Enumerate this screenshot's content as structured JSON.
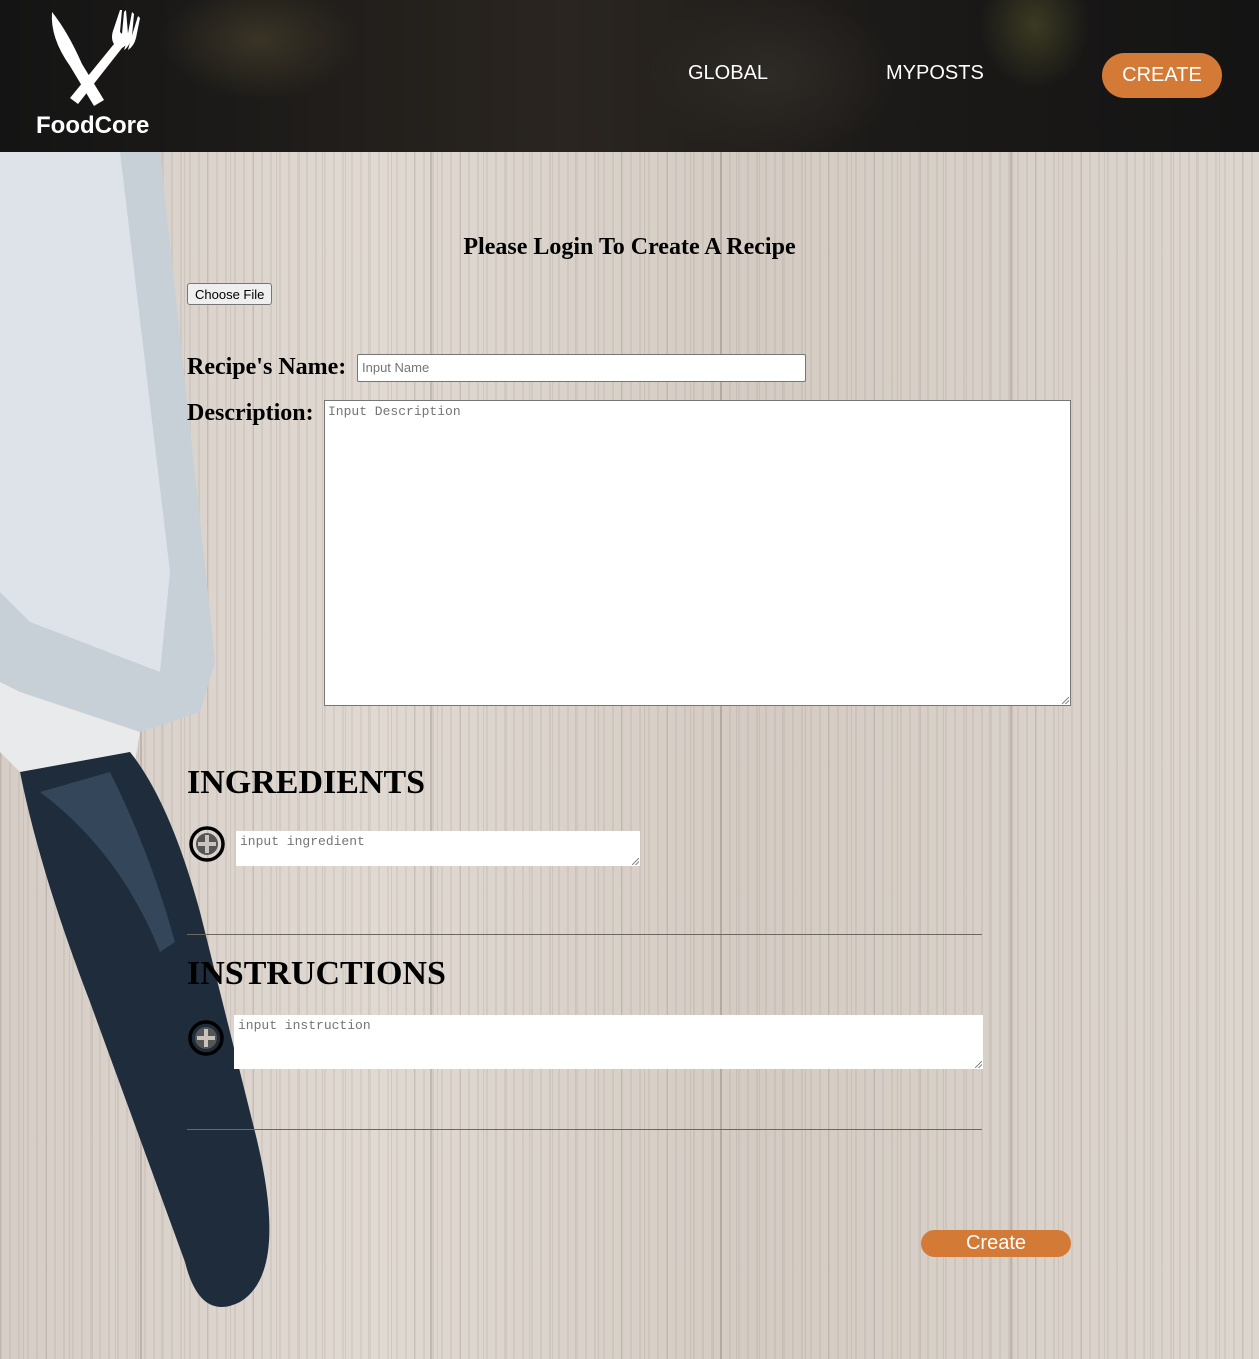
{
  "header": {
    "brand": "FoodCore",
    "nav": {
      "global": "GLOBAL",
      "myposts": "MYPOSTS",
      "create": "CREATE"
    }
  },
  "form": {
    "title": "Please Login To Create A Recipe",
    "file_button": "Choose File",
    "name_label": "Recipe's Name:",
    "name_placeholder": "Input Name",
    "description_label": "Description:",
    "description_placeholder": "Input Description",
    "ingredients_heading": "INGREDIENTS",
    "ingredient_placeholder": "input ingredient",
    "instructions_heading": "INSTRUCTIONS",
    "instruction_placeholder": "input instruction",
    "submit_label": "Create"
  },
  "colors": {
    "accent": "#d37a36",
    "header_bg": "#1a1917"
  },
  "icons": {
    "logo": "knife-fork-icon",
    "add": "plus-circle-icon",
    "file": "file-upload"
  }
}
